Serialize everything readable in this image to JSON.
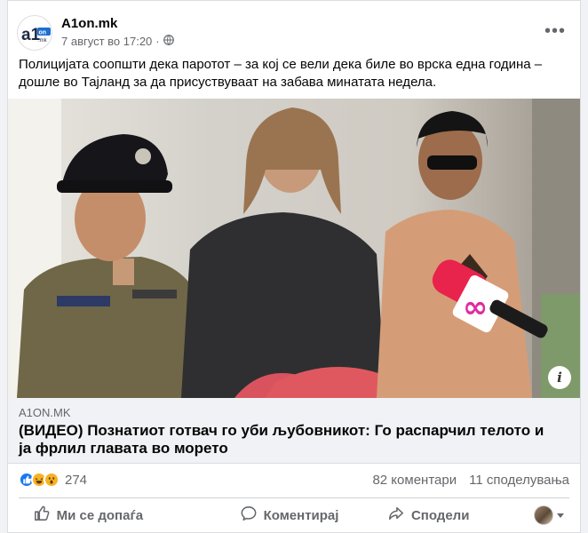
{
  "post": {
    "page_name": "A1on.mk",
    "timestamp": "7 август во 17:20",
    "separator": "·",
    "body_text": "Полицијата соопшти дека паротот – за кој се вели дека биле во врска една година – дошле во Тајланд за да присуствуваат на забава минатата недела.",
    "avatar_text": "a1",
    "avatar_small": "on",
    "avatar_mk": ".mk"
  },
  "photo": {
    "badge_symbol": "∞"
  },
  "link_preview": {
    "domain": "A1ON.MK",
    "title": "(ВИДЕО) Познатиот готвач го уби љубовникот: Го распарчил телото и ја фрлил главата во морето"
  },
  "engagement": {
    "reaction_count": "274",
    "comments": "82 коментари",
    "shares": "11 споделувања",
    "reaction_colors": [
      "#1877f2",
      "#f7b125",
      "#f7b125"
    ]
  },
  "actions": {
    "like": "Ми се допаѓа",
    "comment": "Коментирај",
    "share": "Сподели"
  }
}
